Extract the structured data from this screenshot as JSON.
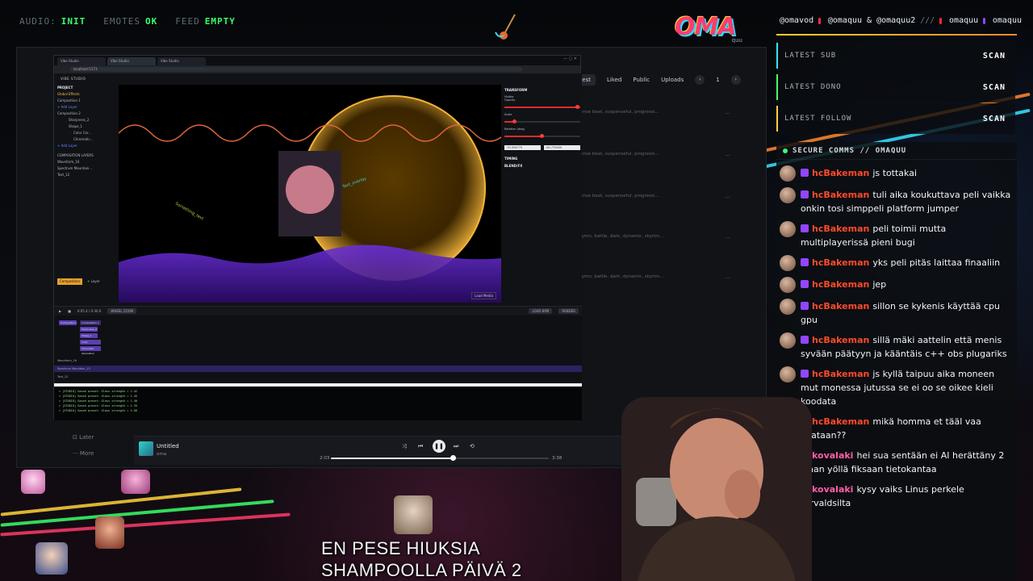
{
  "status": {
    "audio": {
      "key": "AUDIO:",
      "value": "INIT"
    },
    "emotes": {
      "key": "EMOTES",
      "value": "OK"
    },
    "feed": {
      "key": "FEED",
      "value": "EMPTY"
    }
  },
  "logo": {
    "text": "OMA",
    "sub": "quu"
  },
  "socials": {
    "a": "@omavod",
    "b": "@omaquu & @omaquu2",
    "sep": "///",
    "c": "omaquu",
    "d": "omaquu"
  },
  "alerts": [
    {
      "label": "LATEST SUB",
      "value": "SCAN"
    },
    {
      "label": "LATEST DONO",
      "value": "SCAN"
    },
    {
      "label": "LATEST FOLLOW",
      "value": "SCAN"
    }
  ],
  "chat": {
    "title": "SECURE COMMS // OMAQUU",
    "messages": [
      {
        "user": "hcBakeman",
        "text": "js tottakai"
      },
      {
        "user": "hcBakeman",
        "text": "tuli aika koukuttava peli vaikka onkin tosi simppeli platform jumper"
      },
      {
        "user": "hcBakeman",
        "text": "peli toimii mutta multiplayerissä pieni bugi"
      },
      {
        "user": "hcBakeman",
        "text": "yks peli pitäs laittaa finaaliin"
      },
      {
        "user": "hcBakeman",
        "text": "jep"
      },
      {
        "user": "hcBakeman",
        "text": "sillon se kykenis käyttää cpu gpu"
      },
      {
        "user": "hcBakeman",
        "text": "sillä mäki aattelin että menis syvään päätyyn ja kääntäis c++ obs plugariks"
      },
      {
        "user": "hcBakeman",
        "text": "js kyllä taipuu aika moneen mut monessa jutussa se ei oo se oikee kieli koodata"
      },
      {
        "user": "hcBakeman",
        "text": "mikä homma et tääl vaa idlataan??"
      },
      {
        "user": "kovalaki",
        "text": "hei sua sentään ei AI herättäny 2 ikaan yöllä fiksaan tietokantaa"
      },
      {
        "user": "kovalaki",
        "text": "kysy vaiks Linus perkele Torvaldsilta"
      }
    ]
  },
  "music": {
    "filters": [
      "Newest",
      "Liked",
      "Public",
      "Uploads"
    ],
    "page": "1",
    "rows": [
      "lofi, intense beat, suspenseful, progressi...",
      "lofi, intense beat, suspenseful, progressi...",
      "lofi, intense beat, suspenseful, progressi...",
      "deep, hymn, battle, dark, dynamic, skyrim...",
      "deep, hymn, battle, dark, dynamic, skyrim..."
    ],
    "nav": [
      "Later",
      "More"
    ]
  },
  "player": {
    "title": "Untitled",
    "artist": "oma",
    "elapsed": "2:03",
    "duration": "3:38",
    "progress": 0.56
  },
  "editor": {
    "app_title": "VIBE STUDIO",
    "tabs": [
      "Vibe Studio",
      "Vibe Studio",
      "Vibe Studio"
    ],
    "url": "localhost:5173",
    "project_heading": "PROJECT",
    "items": [
      "Global Effects",
      "Composition 1",
      "+ Add Layer",
      "Composition 2",
      "Sharpness_2",
      "Shape_1",
      "Color Cor...",
      "Chromatic...",
      "+ Add Layer",
      "COMPOSITION LAYERS",
      "Waveform_16",
      "Spectrum Mountain...",
      "Text_12"
    ],
    "props_heading": "TRANSFORM",
    "props": [
      "Visible",
      "Opacity",
      "Scale",
      "Rotation (deg)"
    ],
    "fields": [
      "-70.926775",
      "-60.779450"
    ],
    "sections": [
      "TIMING",
      "BLEND/FX"
    ],
    "bottom_buttons": [
      "Composition",
      "+ Layer"
    ],
    "load_media": "Load Media",
    "timecode": "0:05.4 / 0:30.0",
    "zoom_label": "WHEEL ZOOM",
    "transport_buttons": [
      "LOAD BPM",
      "RENDER"
    ],
    "tracks": [
      "Waveform_16",
      "Spectrum Mountain_13",
      "Text_12"
    ],
    "clips": [
      "Composition...",
      "Composition 1",
      "Sharpness_2",
      "Shape_1",
      "Color Correction",
      "Chromatic Aberration"
    ],
    "console": [
      "> [STUDIO] Saved preset: Glass strength = 1.42",
      "> [STUDIO] Saved preset: Glass strength = 1.45",
      "> [STUDIO] Saved preset: Glass strength = 1.40",
      "> [STUDIO] Saved preset: Glass strength = 1.35",
      "> [STUDIO] Saved preset: Glass strength = 3.66"
    ]
  },
  "caption": {
    "line1": "EN PESE HIUKSIA",
    "line2": "SHAMPOOLLA PÄIVÄ 2"
  },
  "colors": {
    "accent_green": "#39ff6a",
    "chat_user": "#ff4b2b",
    "twitch_purple": "#9146ff"
  }
}
